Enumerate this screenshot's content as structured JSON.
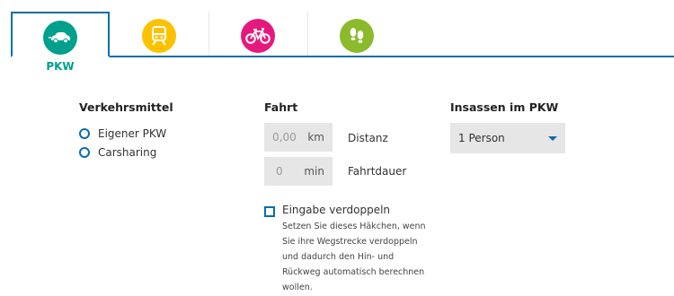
{
  "tabs": [
    {
      "label": "PKW",
      "icon": "car-icon",
      "color": "#00a08c",
      "active": true
    },
    {
      "label": "",
      "icon": "train-icon",
      "color": "#fcc200",
      "active": false
    },
    {
      "label": "",
      "icon": "bicycle-icon",
      "color": "#e5197d",
      "active": false
    },
    {
      "label": "",
      "icon": "footsteps-icon",
      "color": "#8cba2d",
      "active": false
    }
  ],
  "verkehrsmittel": {
    "heading": "Verkehrsmittel",
    "options": [
      "Eigener PKW",
      "Carsharing"
    ]
  },
  "fahrt": {
    "heading": "Fahrt",
    "distance": {
      "placeholder": "0,00",
      "unit": "km",
      "label": "Distanz"
    },
    "duration": {
      "placeholder": "0",
      "unit": "min",
      "label": "Fahrtdauer"
    },
    "double": {
      "label": "Eingabe verdoppeln",
      "help_lines": [
        "Setzen Sie dieses Häkchen, wenn",
        "Sie ihre Wegstrecke verdoppeln",
        "und dadurch den Hin- und",
        "Rückweg automatisch berechnen",
        "wollen."
      ]
    }
  },
  "insassen": {
    "heading": "Insassen im PKW",
    "selected": "1 Person"
  },
  "colors": {
    "accent_blue": "#0a6ea8",
    "pkw_green": "#00a08c"
  }
}
